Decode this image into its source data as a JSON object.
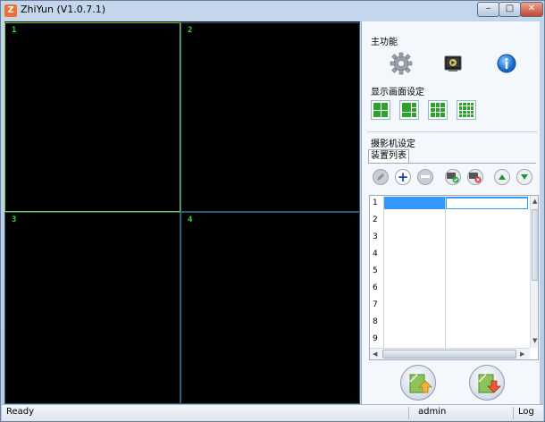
{
  "window": {
    "title": "ZhiYun (V1.0.7.1)",
    "app_icon_glyph": "Z",
    "min_glyph": "–",
    "max_glyph": "□",
    "close_glyph": "✕"
  },
  "video_grid": {
    "cells": [
      {
        "number": "1",
        "selected": true
      },
      {
        "number": "2",
        "selected": false
      },
      {
        "number": "3",
        "selected": false
      },
      {
        "number": "4",
        "selected": false
      }
    ]
  },
  "panel": {
    "main_functions_label": "主功能",
    "main_function_icons": [
      "gear-icon",
      "video-playback-icon",
      "info-icon"
    ],
    "display_settings_label": "显示画面设定",
    "layout_options": [
      "1x1",
      "1+5",
      "3x3",
      "4x4"
    ],
    "camera_settings_label": "摄影机设定",
    "device_list_tab": "装置列表",
    "toolbar_icons": [
      "edit-icon",
      "add-icon",
      "remove-icon",
      "camera-connect-icon",
      "camera-disconnect-icon",
      "move-up-icon",
      "move-down-icon"
    ],
    "device_rows": [
      "1",
      "2",
      "3",
      "4",
      "5",
      "6",
      "7",
      "8",
      "9"
    ],
    "selected_row": "1",
    "bottom_buttons": [
      "import-icon",
      "export-icon"
    ]
  },
  "statusbar": {
    "status": "Ready",
    "user": "admin",
    "log": "Log"
  },
  "colors": {
    "cell_number": "#2fd92f",
    "selected_cell_border": "#7acd3d",
    "cell_border": "#2a5e7a",
    "selection": "#3399ff",
    "layout_green": "#2ca32a"
  }
}
